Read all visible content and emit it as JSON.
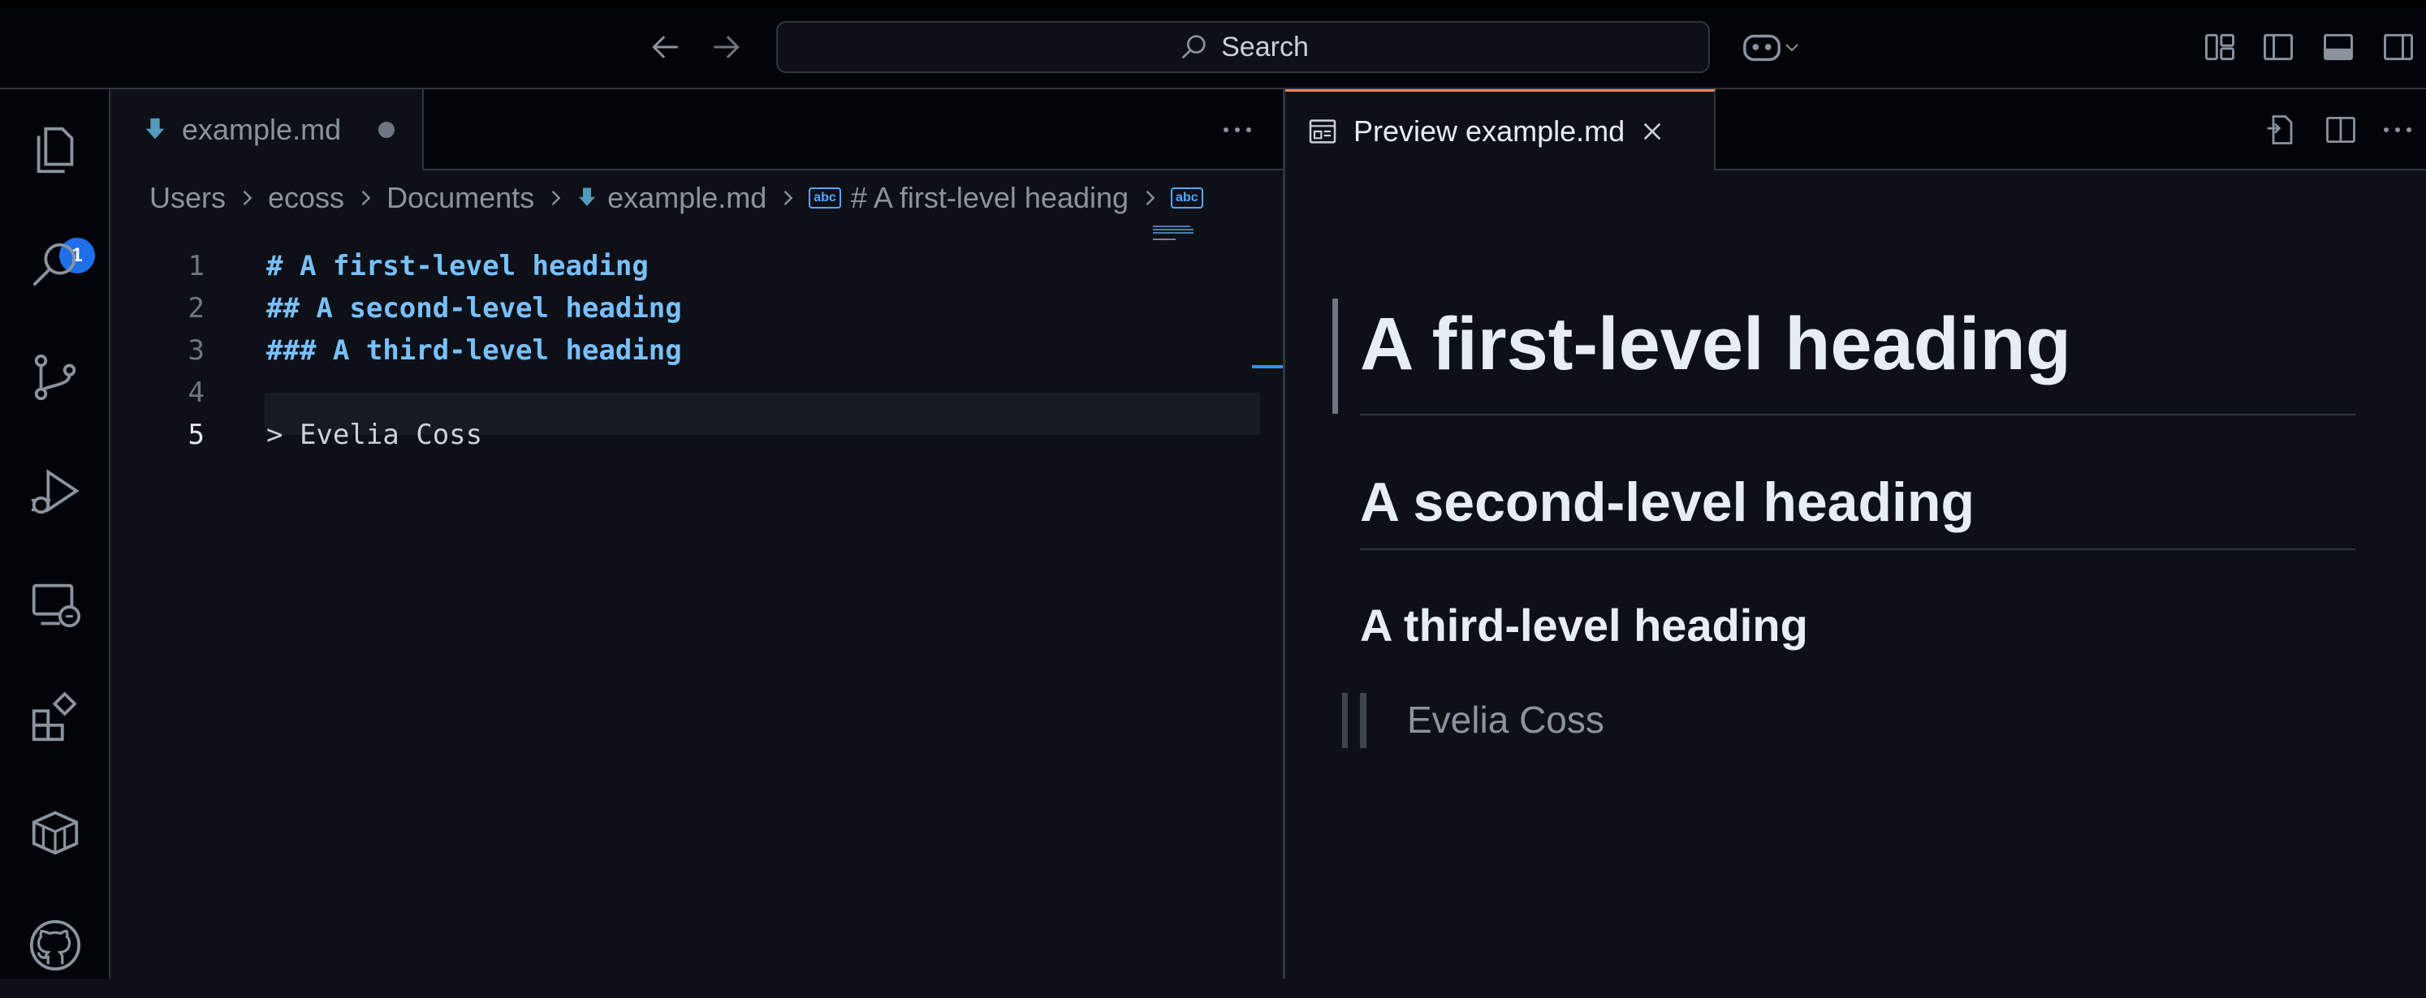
{
  "titlebar": {
    "search_label": "Search"
  },
  "activity": {
    "explorer_badge": "1"
  },
  "editor": {
    "tab_label": "example.md",
    "breadcrumb": {
      "users": "Users",
      "user": "ecoss",
      "folder": "Documents",
      "file": "example.md",
      "symbol": "# A first-level heading",
      "abc_label": "abc"
    },
    "lines": [
      {
        "number": "1",
        "text": "# A first-level heading"
      },
      {
        "number": "2",
        "text": "## A second-level heading"
      },
      {
        "number": "3",
        "text": "### A third-level heading"
      },
      {
        "number": "4",
        "text": ""
      },
      {
        "number": "5",
        "text": "> Evelia Coss"
      }
    ]
  },
  "preview": {
    "tab_label": "Preview example.md",
    "h1": "A first-level heading",
    "h2": "A second-level heading",
    "h3": "A third-level heading",
    "blockquote": "Evelia Coss"
  },
  "colors": {
    "background": "#0d1117",
    "accent": "#1f6feb",
    "heading_code": "#79c0ff",
    "tab_active_border": "#f78166"
  }
}
